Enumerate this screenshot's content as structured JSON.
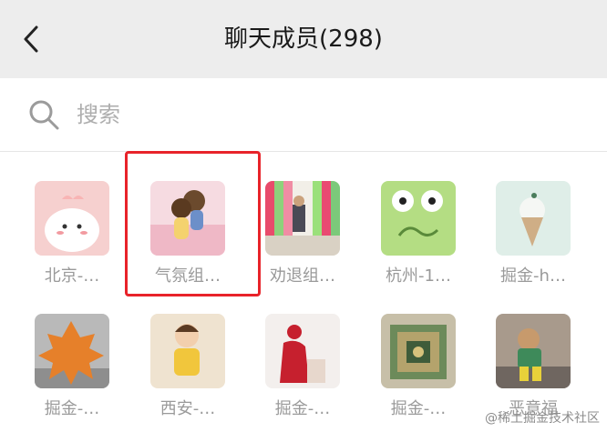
{
  "header": {
    "title": "聊天成员(298)",
    "back_icon": "chevron-left-icon"
  },
  "search": {
    "placeholder": "搜索",
    "icon": "search-icon"
  },
  "members": [
    {
      "name": "北京-…"
    },
    {
      "name": "气氛组…"
    },
    {
      "name": "劝退组…"
    },
    {
      "name": "杭州-1…"
    },
    {
      "name": "掘金-h…"
    },
    {
      "name": "掘金-…"
    },
    {
      "name": "西安-…"
    },
    {
      "name": "掘金-…"
    },
    {
      "name": "掘金-…"
    },
    {
      "name": "恶意福"
    }
  ],
  "highlight_color": "#e8232a",
  "watermark": "@稀土掘金技术社区"
}
